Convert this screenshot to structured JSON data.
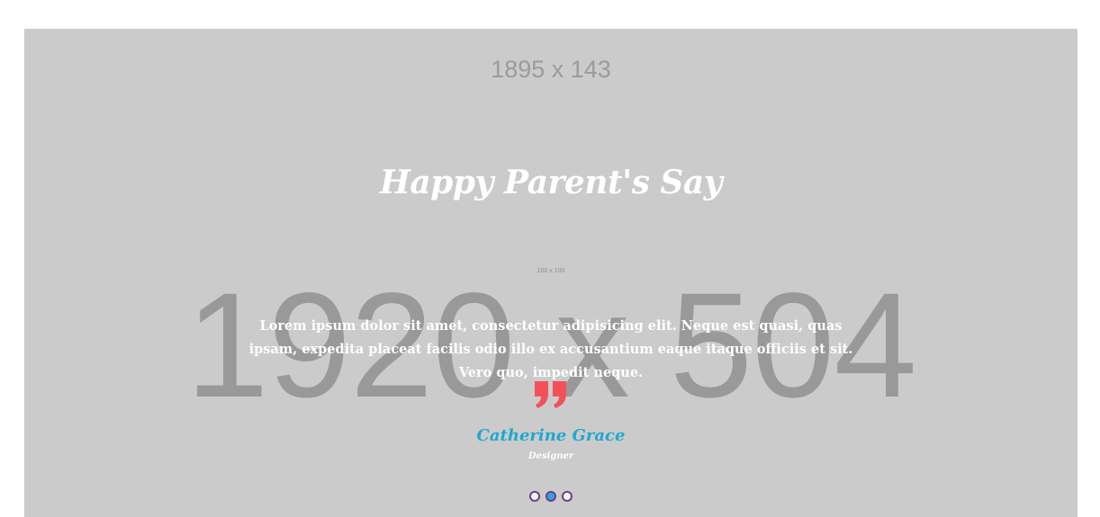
{
  "header_placeholder": "1895 x 143",
  "background_placeholder": "1920 x 504",
  "title": "Happy Parent's Say",
  "avatar_placeholder": "100 x 100",
  "testimonial": {
    "text": "Lorem ipsum dolor sit amet, consectetur adipisicing elit. Neque est quasi, quas ipsam, expedita placeat facilis odio illo ex accusantium eaque itaque officiis et sit. Vero quo, impedit neque.",
    "quote_icon": "quote-right-icon",
    "name": "Catherine Grace",
    "role": "Designer"
  },
  "pagination": {
    "count": 3,
    "active_index": 1
  },
  "colors": {
    "section_bg": "#cbcbcb",
    "quote_icon": "#f4505a",
    "name": "#1ea8cf",
    "dot_border": "#6d3a8f",
    "dot_active": "#2ea8dc"
  }
}
